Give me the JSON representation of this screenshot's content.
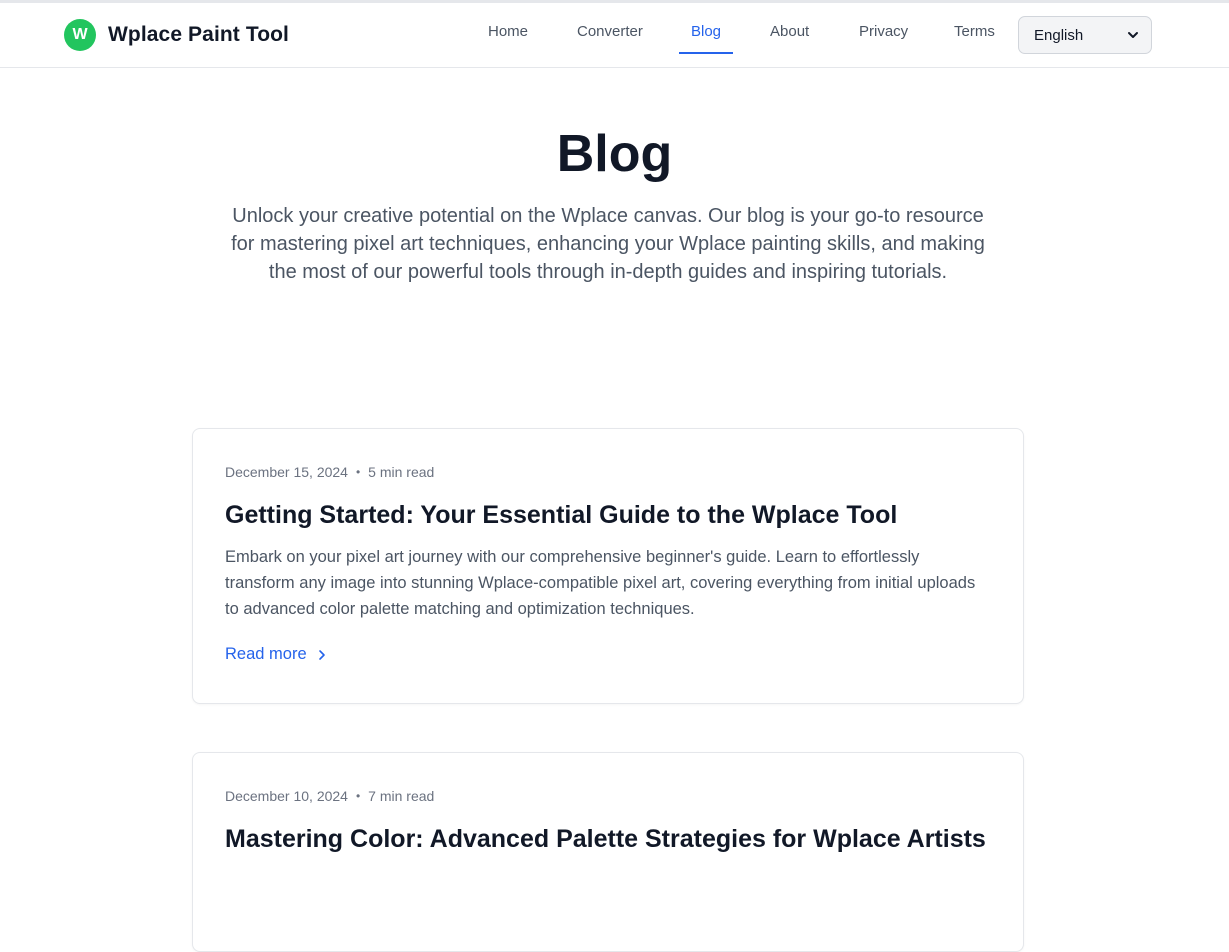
{
  "header": {
    "logo_letter": "W",
    "brand": "Wplace Paint Tool",
    "nav": [
      {
        "label": "Home"
      },
      {
        "label": "Converter"
      },
      {
        "label": "Blog",
        "active": true
      },
      {
        "label": "About"
      },
      {
        "label": "Privacy"
      },
      {
        "label": "Terms"
      }
    ],
    "language": "English"
  },
  "hero": {
    "title": "Blog",
    "subtitle": "Unlock your creative potential on the Wplace canvas. Our blog is your go-to resource for mastering pixel art techniques, enhancing your Wplace painting skills, and making the most of our powerful tools through in-depth guides and inspiring tutorials."
  },
  "posts": [
    {
      "date": "December 15, 2024",
      "read_time": "5 min read",
      "title": "Getting Started: Your Essential Guide to the Wplace Tool",
      "excerpt": "Embark on your pixel art journey with our comprehensive beginner's guide. Learn to effortlessly transform any image into stunning Wplace-compatible pixel art, covering everything from initial uploads to advanced color palette matching and optimization techniques.",
      "read_more": "Read more"
    },
    {
      "date": "December 10, 2024",
      "read_time": "7 min read",
      "title": "Mastering Color: Advanced Palette Strategies for Wplace Artists"
    }
  ],
  "colors": {
    "brand": "#22c55e",
    "accent": "#2563eb",
    "text": "#111827",
    "muted": "#4b5563"
  },
  "icons": {
    "read_more": "chevron-right-icon",
    "select": "chevron-down-icon"
  }
}
